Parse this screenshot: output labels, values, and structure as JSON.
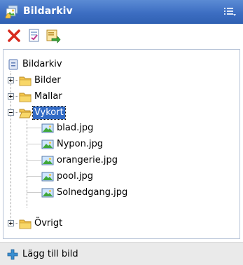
{
  "header": {
    "title": "Bildarkiv",
    "icon": "image-gallery-icon",
    "menu_icon": "options-list-icon"
  },
  "toolbar": {
    "buttons": [
      {
        "name": "delete",
        "icon": "red-x-delete-icon"
      },
      {
        "name": "edit",
        "icon": "edit-document-icon"
      },
      {
        "name": "export",
        "icon": "export-arrow-icon"
      }
    ]
  },
  "tree": {
    "root": {
      "label": "Bildarkiv",
      "icon": "archive-icon"
    },
    "folders": [
      {
        "label": "Bilder",
        "expanded": false
      },
      {
        "label": "Mallar",
        "expanded": false
      },
      {
        "label": "Vykort",
        "expanded": true,
        "selected": true,
        "files": [
          "blad.jpg",
          "Nypon.jpg",
          "orangerie.jpg",
          "pool.jpg",
          "Solnedgang.jpg"
        ]
      },
      {
        "label": "Övrigt",
        "expanded": false
      }
    ]
  },
  "footer": {
    "add_label": "Lägg till bild",
    "add_icon": "plus-icon"
  },
  "colors": {
    "header_bg": "#3d6ec2",
    "selection_bg": "#316ac5",
    "folder": "#f3c54a",
    "delete": "#d82a1e"
  }
}
